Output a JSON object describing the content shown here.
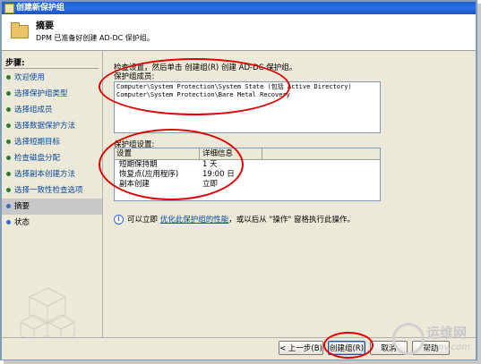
{
  "window": {
    "title": "创建新保护组"
  },
  "header": {
    "title": "摘要",
    "description": "DPM 已准备好创建 AD-DC 保护组。"
  },
  "sidebar": {
    "title": "步骤:",
    "steps": [
      {
        "label": "欢迎使用"
      },
      {
        "label": "选择保护组类型"
      },
      {
        "label": "选择组成员"
      },
      {
        "label": "选择数据保护方法"
      },
      {
        "label": "选择短期目标"
      },
      {
        "label": "检查磁盘分配"
      },
      {
        "label": "选择副本创建方法"
      },
      {
        "label": "选择一致性检查选项"
      },
      {
        "label": "摘要"
      },
      {
        "label": "状态"
      }
    ]
  },
  "main": {
    "instruction": "检查设置，然后单击 创建组(R) 创建 AD-DC 保护组。",
    "members_label": "保护组成员:",
    "members": [
      "Computer\\System Protection\\System State (包括 Active Directory)",
      "Computer\\System Protection\\Bare Metal Recovery"
    ],
    "settings_label": "保护组设置:",
    "settings_headers": [
      "设置",
      "详细信息"
    ],
    "settings_rows": [
      {
        "setting": "短期保持期",
        "detail": "1 天"
      },
      {
        "setting": "恢复点(应用程序)",
        "detail": "19:00 日"
      },
      {
        "setting": "副本创建",
        "detail": "立即"
      }
    ],
    "info_prefix": "可以立即",
    "info_link": "优化此保护组的性能",
    "info_suffix": "，或以后从 \"操作\" 窗格执行此操作。"
  },
  "footer": {
    "back_label": "< 上一步(B)",
    "create_label": "创建组(R)",
    "cancel_label": "取消",
    "help_label": "帮助"
  },
  "watermark": {
    "brand": "运维网",
    "url": "iyunv.com"
  },
  "colors": {
    "title_bar": "#2a6ee8",
    "annotation": "#e00000",
    "link": "#0b4a9c"
  }
}
